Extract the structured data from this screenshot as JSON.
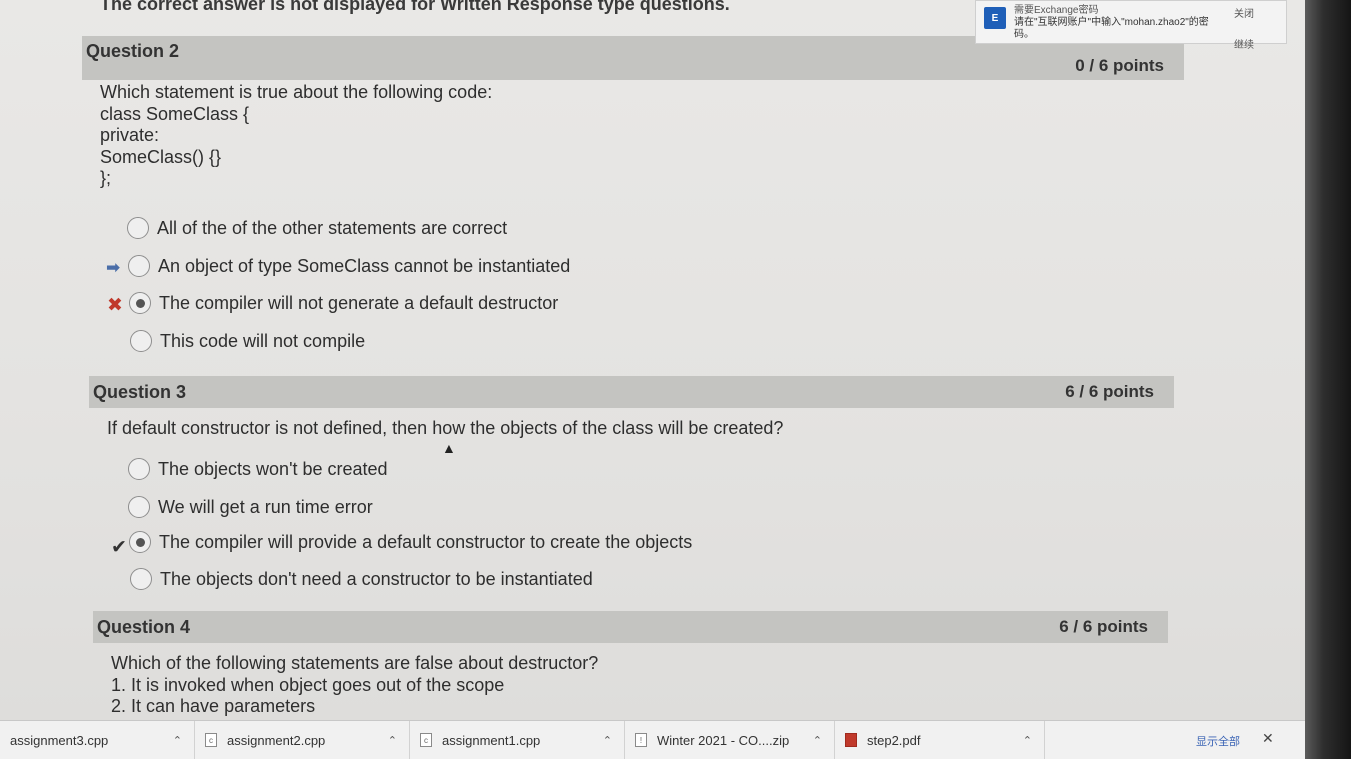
{
  "top": {
    "note": "The correct answer is not displayed for Written Response type questions.",
    "url_fragment": "...&isInPopup=0&cfql=0&i..."
  },
  "notification": {
    "title": "需要Exchange密码",
    "message": "请在\"互联网账户\"中输入\"mohan.zhao2\"的密码。",
    "close_label": "关闭",
    "continue_label": "继续"
  },
  "questions": [
    {
      "title": "Question 2",
      "points": "0 / 6 points",
      "text_lines": [
        "Which statement is true about the following code:",
        "class SomeClass {",
        "private:",
        "SomeClass() {}",
        "};"
      ],
      "options": [
        "All of the of the other statements are correct",
        "An object of type SomeClass cannot be instantiated",
        "The compiler will not generate a default destructor",
        "This code will not compile"
      ]
    },
    {
      "title": "Question 3",
      "points": "6 / 6 points",
      "text_lines": [
        "If default constructor is not defined, then how the objects of the class will be created?"
      ],
      "options": [
        "The objects won't be created",
        "We will get a run time error",
        "The compiler will provide a default constructor to create the objects",
        "The objects don't need a constructor to be instantiated"
      ]
    },
    {
      "title": "Question 4",
      "points": "6 / 6 points",
      "text_lines": [
        "Which of the following statements are false about destructor?",
        "1. It is invoked when object goes out of the scope",
        "2. It can have parameters"
      ]
    }
  ],
  "downloads": {
    "items": [
      {
        "name": "assignment3.cpp",
        "icon": "file-icon"
      },
      {
        "name": "assignment2.cpp",
        "icon": "file-icon"
      },
      {
        "name": "assignment1.cpp",
        "icon": "file-icon"
      },
      {
        "name": "Winter 2021 - CO....zip",
        "icon": "zip-icon"
      },
      {
        "name": "step2.pdf",
        "icon": "pdf-icon"
      }
    ],
    "show_all_label": "显示全部",
    "close_glyph": "✕"
  },
  "markers": {
    "arrow": "➡",
    "cross": "✖",
    "check": "✔"
  },
  "colors": {
    "header_bg": "#c4c4c1",
    "arrow": "#4b6ea8",
    "cross": "#c0392b"
  }
}
